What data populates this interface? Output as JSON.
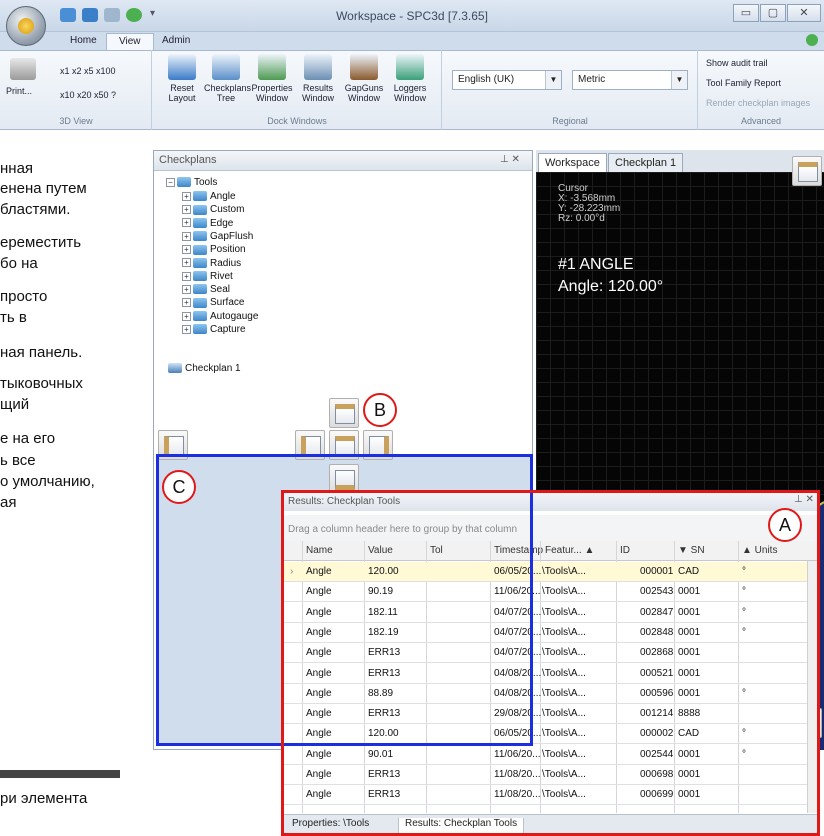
{
  "window": {
    "title": "Workspace - SPC3d [7.3.65]",
    "buttons": [
      "▭",
      "▢",
      "✕"
    ]
  },
  "tabs": [
    {
      "label": "Home"
    },
    {
      "label": "View"
    },
    {
      "label": "Admin"
    }
  ],
  "ribbon": {
    "view3d": {
      "print_label": "Print...",
      "zoom_row1": "x1  x2  x5  x100",
      "zoom_row2": "x10  x20  x50  ?",
      "group_label": "3D View"
    },
    "dock_buttons": [
      {
        "label": "Reset Layout",
        "color": "#3a7bc8"
      },
      {
        "label": "Checkplans Tree",
        "color": "#5a8fc9"
      },
      {
        "label": "Properties Window",
        "color": "#4e9a52"
      },
      {
        "label": "Results Window",
        "color": "#6b8fb3"
      },
      {
        "label": "GapGuns Window",
        "color": "#8a5a2e"
      },
      {
        "label": "Loggers Window",
        "color": "#3aa07a"
      }
    ],
    "dock_group_label": "Dock Windows",
    "language": "English (UK)",
    "units": "Metric",
    "regional_label": "Regional",
    "advanced": {
      "items": [
        "Show audit trail",
        "Tool Family Report",
        "Render checkplan images"
      ],
      "group_label": "Advanced"
    }
  },
  "background_doc": {
    "lines": [
      "нная",
      "енена путем",
      "бластями.",
      "ереместить",
      "бо на",
      "просто",
      "ть в",
      "ная панель.",
      "тыковочных",
      "щий",
      "е на его",
      "ь все",
      "о умолчанию,",
      "ая",
      "ри элемента"
    ]
  },
  "checkplans": {
    "title": "Checkplans",
    "pin": "⊥  ✕",
    "root": "Tools",
    "items": [
      "Angle",
      "Custom",
      "Edge",
      "GapFlush",
      "Position",
      "Radius",
      "Rivet",
      "Seal",
      "Surface",
      "Autogauge",
      "Capture"
    ],
    "checkplan": "Checkplan 1"
  },
  "workspace": {
    "tabs": [
      "Workspace",
      "Checkplan 1"
    ],
    "cursor": {
      "label": "Cursor",
      "x": "X: -3.568mm",
      "y": "Y: -28.223mm",
      "rz": "Rz: 0.00°d"
    },
    "feature": {
      "name": "#1 ANGLE",
      "angle": "Angle: 120.00°"
    }
  },
  "results": {
    "title": "Results: Checkplan Tools",
    "group_hint": "Drag a column header here to group by that column",
    "columns": [
      "Name",
      "Value",
      "Tol",
      "Timestamp",
      "Featur... ▲",
      "ID",
      "▼ SN",
      "▲ Units"
    ],
    "rows": [
      {
        "name": "Angle",
        "value": "120.00",
        "tol": "",
        "ts": "06/05/20...",
        "feat": "\\Tools\\A...",
        "id": "000001",
        "sn": "CAD",
        "units": "°"
      },
      {
        "name": "Angle",
        "value": "90.19",
        "tol": "",
        "ts": "11/06/20...",
        "feat": "\\Tools\\A...",
        "id": "002543",
        "sn": "0001",
        "units": "°"
      },
      {
        "name": "Angle",
        "value": "182.11",
        "tol": "",
        "ts": "04/07/20...",
        "feat": "\\Tools\\A...",
        "id": "002847",
        "sn": "0001",
        "units": "°"
      },
      {
        "name": "Angle",
        "value": "182.19",
        "tol": "",
        "ts": "04/07/20...",
        "feat": "\\Tools\\A...",
        "id": "002848",
        "sn": "0001",
        "units": "°"
      },
      {
        "name": "Angle",
        "value": "ERR13",
        "tol": "",
        "ts": "04/07/20...",
        "feat": "\\Tools\\A...",
        "id": "002868",
        "sn": "0001",
        "units": ""
      },
      {
        "name": "Angle",
        "value": "ERR13",
        "tol": "",
        "ts": "04/08/20...",
        "feat": "\\Tools\\A...",
        "id": "000521",
        "sn": "0001",
        "units": ""
      },
      {
        "name": "Angle",
        "value": "88.89",
        "tol": "",
        "ts": "04/08/20...",
        "feat": "\\Tools\\A...",
        "id": "000596",
        "sn": "0001",
        "units": "°"
      },
      {
        "name": "Angle",
        "value": "ERR13",
        "tol": "",
        "ts": "29/08/20...",
        "feat": "\\Tools\\A...",
        "id": "001214",
        "sn": "8888",
        "units": ""
      },
      {
        "name": "Angle",
        "value": "120.00",
        "tol": "",
        "ts": "06/05/20...",
        "feat": "\\Tools\\A...",
        "id": "000002",
        "sn": "CAD",
        "units": "°"
      },
      {
        "name": "Angle",
        "value": "90.01",
        "tol": "",
        "ts": "11/06/20...",
        "feat": "\\Tools\\A...",
        "id": "002544",
        "sn": "0001",
        "units": "°"
      },
      {
        "name": "Angle",
        "value": "ERR13",
        "tol": "",
        "ts": "11/08/20...",
        "feat": "\\Tools\\A...",
        "id": "000698",
        "sn": "0001",
        "units": ""
      },
      {
        "name": "Angle",
        "value": "ERR13",
        "tol": "",
        "ts": "11/08/20...",
        "feat": "\\Tools\\A...",
        "id": "000699",
        "sn": "0001",
        "units": ""
      }
    ],
    "bottom_tabs": [
      "Properties: \\Tools",
      "Results: Checkplan Tools"
    ]
  },
  "callouts": {
    "a": "A",
    "b": "B",
    "c": "C"
  },
  "colors": {
    "highlight_red": "#e01818",
    "highlight_blue": "#1b2ee0",
    "selected_row": "#fff9d6"
  }
}
